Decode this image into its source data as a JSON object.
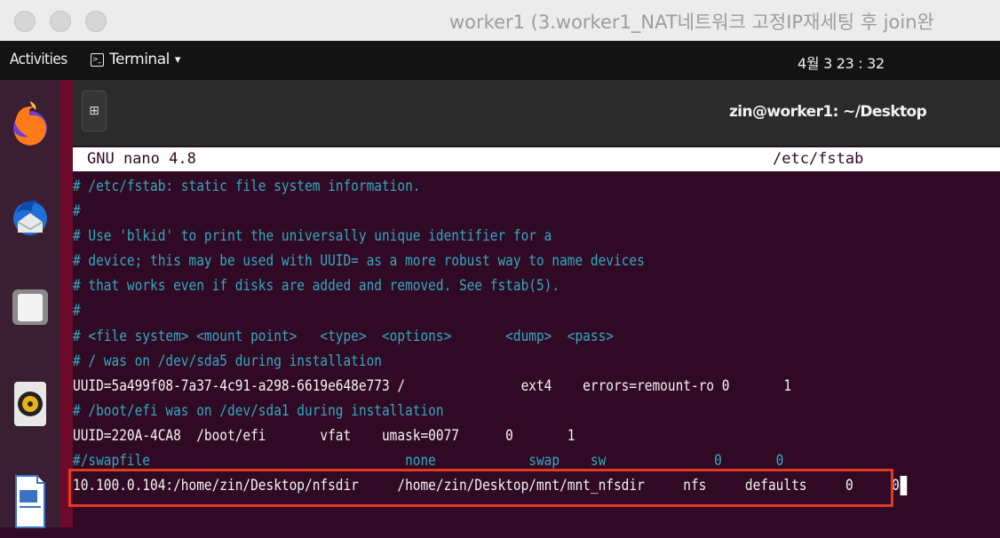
{
  "vm_window": {
    "title": "worker1  (3.worker1_NAT네트워크 고정IP재세팅 후 join완"
  },
  "topbar": {
    "activities": "Activities",
    "app_menu": "Terminal",
    "app_menu_arrow": "▾",
    "clock": "4월 3 23 : 32"
  },
  "dock": {
    "items": [
      {
        "name": "firefox-icon"
      },
      {
        "name": "thunderbird-icon"
      },
      {
        "name": "files-icon"
      },
      {
        "name": "rhythmbox-icon"
      },
      {
        "name": "libreoffice-writer-icon"
      }
    ]
  },
  "terminal": {
    "title": "zin@worker1: ~/Desktop",
    "new_tab_glyph": "⊞"
  },
  "nano": {
    "version": "GNU nano 4.8",
    "filename": "/etc/fstab",
    "lines": [
      {
        "text": "# /etc/fstab: static file system information.",
        "type": "comment"
      },
      {
        "text": "#",
        "type": "comment"
      },
      {
        "text": "# Use 'blkid' to print the universally unique identifier for a",
        "type": "comment"
      },
      {
        "text": "# device; this may be used with UUID= as a more robust way to name devices",
        "type": "comment"
      },
      {
        "text": "# that works even if disks are added and removed. See fstab(5).",
        "type": "comment"
      },
      {
        "text": "#",
        "type": "comment"
      },
      {
        "text": "# <file system> <mount point>   <type>  <options>       <dump>  <pass>",
        "type": "comment"
      },
      {
        "text": "# / was on /dev/sda5 during installation",
        "type": "comment"
      },
      {
        "text": "UUID=5a499f08-7a37-4c91-a298-6619e648e773 /               ext4    errors=remount-ro 0       1",
        "type": "normal"
      },
      {
        "text": "# /boot/efi was on /dev/sda1 during installation",
        "type": "comment"
      },
      {
        "text": "UUID=220A-4CA8  /boot/efi       vfat    umask=0077      0       1",
        "type": "normal"
      },
      {
        "text": "#/swapfile                                 none            swap    sw              0       0",
        "type": "comment"
      },
      {
        "text": "10.100.0.104:/home/zin/Desktop/nfsdir     /home/zin/Desktop/mnt/mnt_nfsdir     nfs     defaults     0     0",
        "type": "normal"
      }
    ]
  },
  "colors": {
    "terminal_bg": "#300a24",
    "comment": "#34a8c2",
    "highlight_border": "#e03a22"
  }
}
